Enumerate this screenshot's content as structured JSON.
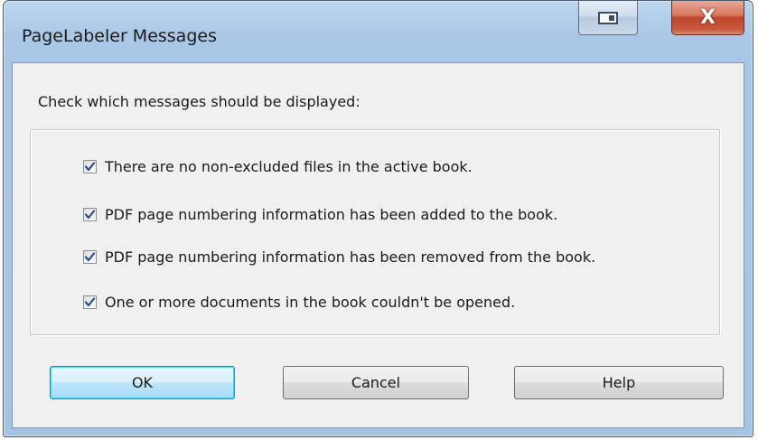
{
  "window": {
    "title": "PageLabeler Messages"
  },
  "titlebar": {
    "restore_icon": "restore-icon",
    "close_icon": "close-icon",
    "close_glyph": "X"
  },
  "dialog": {
    "prompt": "Check which messages should be displayed:",
    "options": [
      {
        "label": "There are no non-excluded files in the active book.",
        "checked": true
      },
      {
        "label": "PDF page numbering information has been added to the book.",
        "checked": true
      },
      {
        "label": "PDF page numbering information has been removed from the book.",
        "checked": true
      },
      {
        "label": "One or more documents in the book couldn't be opened.",
        "checked": true
      }
    ]
  },
  "buttons": {
    "ok": "OK",
    "cancel": "Cancel",
    "help": "Help"
  },
  "colors": {
    "frame": "#a9c7e6",
    "client": "#f0f0f0",
    "close_button": "#c0452b",
    "default_button_border": "#3c7fb1"
  }
}
